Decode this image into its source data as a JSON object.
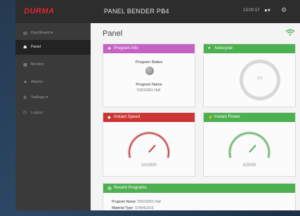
{
  "header": {
    "brand": "DURMA",
    "title": "PANEL BENDER PB4",
    "clock": "13:00:17",
    "user_menu": "▾"
  },
  "sidebar": {
    "items": [
      {
        "icon": "▤",
        "label": "Dashboard ▾"
      },
      {
        "icon": "☗",
        "label": "Panel"
      },
      {
        "icon": "▦",
        "label": "Monitor"
      },
      {
        "icon": "▲",
        "label": "Alarms"
      },
      {
        "icon": "⚙",
        "label": "Settings ▾"
      },
      {
        "icon": "⏻",
        "label": "Logout"
      }
    ]
  },
  "main": {
    "page_title": "Panel",
    "program_info": {
      "title": "Program Info",
      "status_label": "Program Status",
      "name_label": "Program Name",
      "name_value": "D0010001.HqF"
    },
    "autocycle": {
      "title": "Autocycle",
      "value": "0/1"
    },
    "instant_speed": {
      "title": "Instant Speed",
      "value": "0/10000",
      "level": 0
    },
    "instant_power": {
      "title": "Instant Power",
      "value": "0/2000",
      "level": 0
    },
    "recent_programs": {
      "title": "Recent Programs",
      "name_label": "Program Name:",
      "name_value": "D0010001.HqF",
      "material_label": "Material Type:",
      "material_value": "STAINLESS"
    }
  },
  "colors": {
    "brand_red": "#e0262f",
    "program_info_header": "#c462c4",
    "autocycle_header": "#4caf50",
    "instant_speed_header": "#cd3434",
    "instant_power_header": "#4caf50",
    "recent_programs_header": "#4caf50",
    "sidebar_bg": "#3a3a3a",
    "topbar_bg": "#2d2d2d"
  },
  "icons": {
    "user": "user-icon",
    "settings": "gear-icon",
    "wifi": "wifi-icon"
  }
}
